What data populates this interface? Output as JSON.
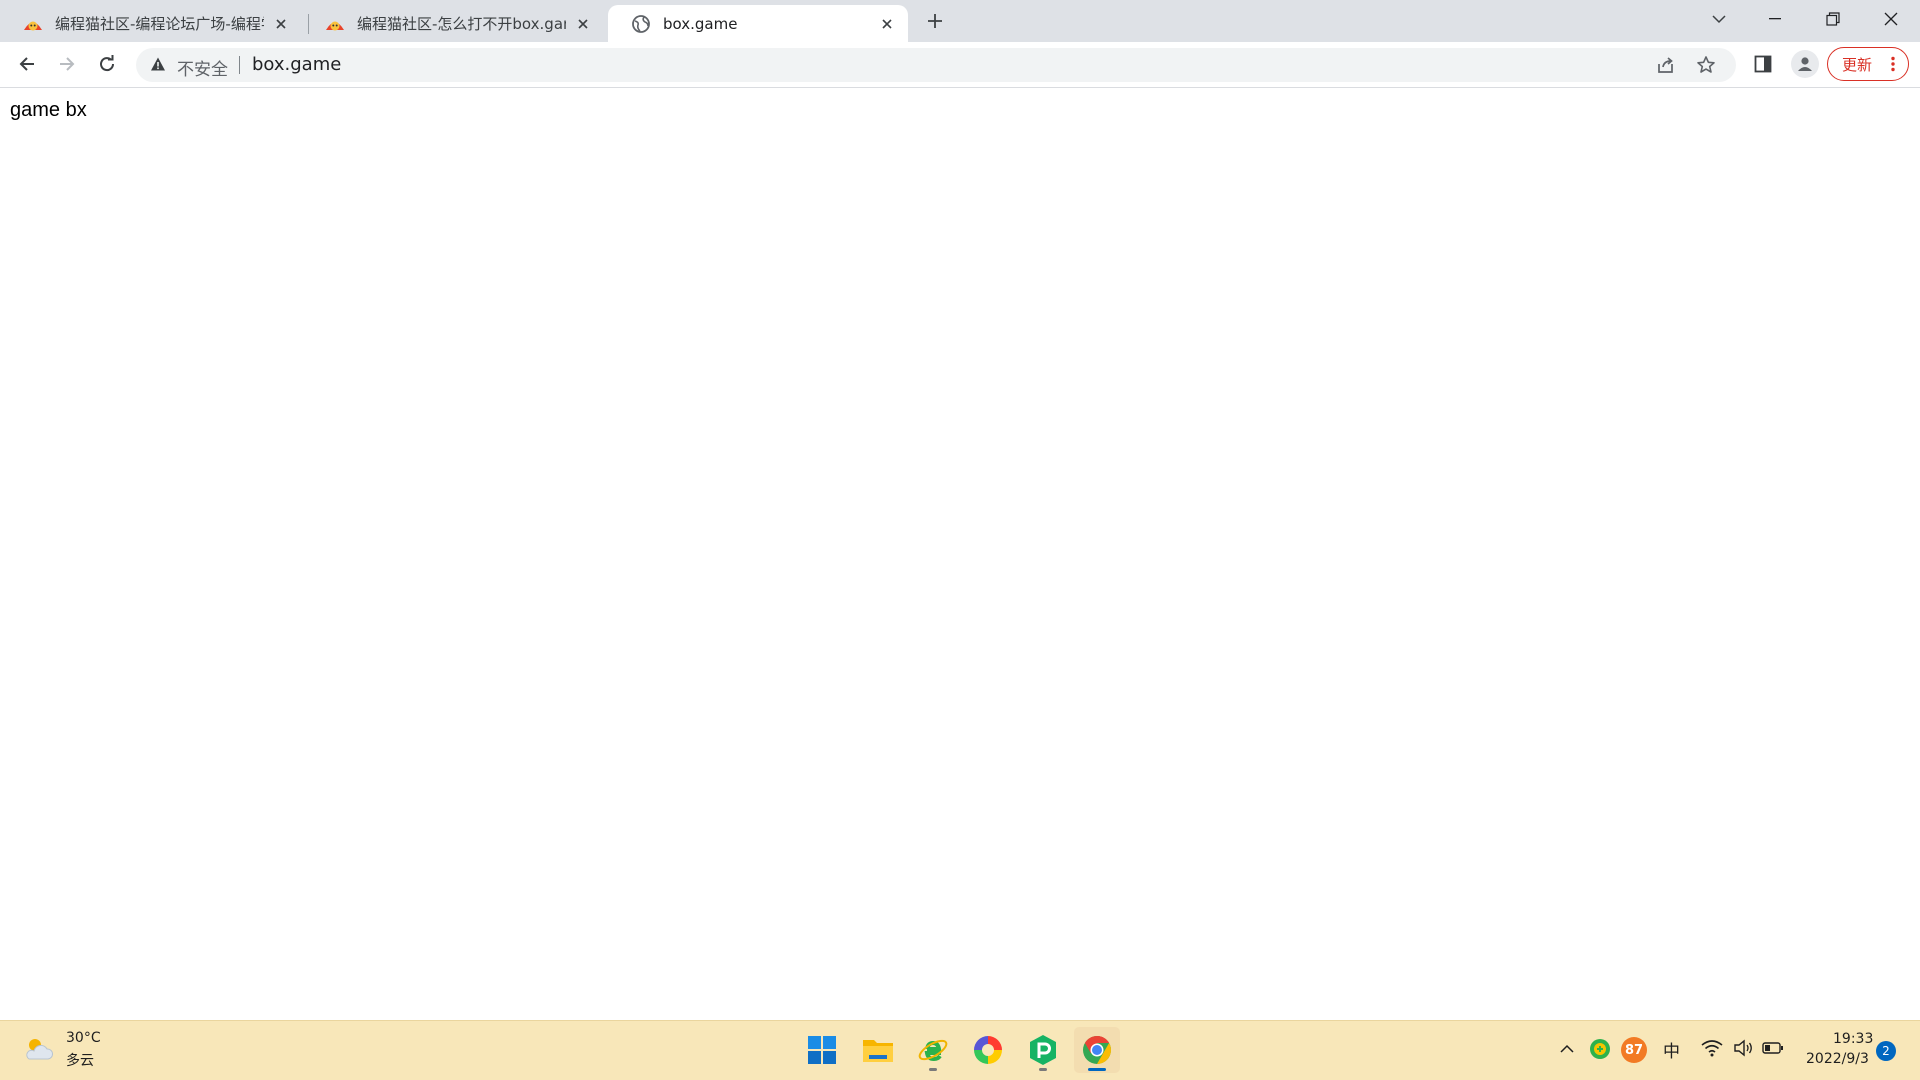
{
  "browser": {
    "tabs": [
      {
        "title": "编程猫社区-编程论坛广场-编程学",
        "active": false
      },
      {
        "title": "编程猫社区-怎么打不开box.game",
        "active": false
      },
      {
        "title": "box.game",
        "active": true
      }
    ],
    "omnibox": {
      "security_label": "不安全",
      "url": "box.game"
    },
    "update_label": "更新"
  },
  "page": {
    "text": "game bx"
  },
  "taskbar": {
    "weather": {
      "temp": "30°C",
      "desc": "多云"
    },
    "tray": {
      "badge_value": "87",
      "ime": "中"
    },
    "clock": {
      "time": "19:33",
      "date": "2022/9/3"
    },
    "notification_count": "2"
  },
  "colors": {
    "tab_strip": "#dee1e6",
    "taskbar": "#f8e7b9",
    "update_accent": "#d93025",
    "windows_accent": "#0067c0"
  }
}
